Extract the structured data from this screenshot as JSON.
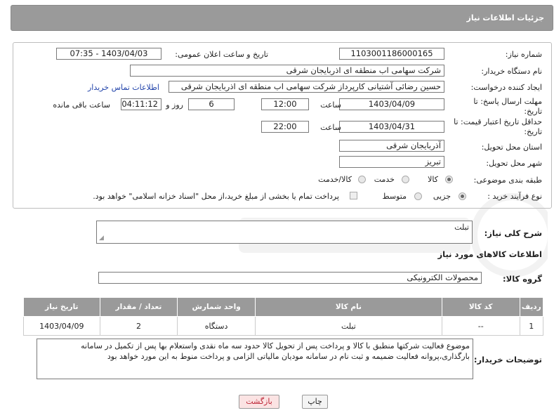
{
  "header": {
    "title": "جزئیات اطلاعات نیاز"
  },
  "form": {
    "need_number_label": "شماره نیاز:",
    "need_number": "1103001186000165",
    "announce_label": "تاریخ و ساعت اعلان عمومی:",
    "announce_value": "1403/04/03 - 07:35",
    "buyer_org_label": "نام دستگاه خریدار:",
    "buyer_org": "شرکت سهامی اب منطقه ای اذربایجان شرقی",
    "creator_label": "ایجاد کننده درخواست:",
    "creator": "حسین رضائی آشتیانی کارپرداز شرکت سهامی اب منطقه ای اذربایجان شرقی",
    "contact_link": "اطلاعات تماس خریدار",
    "deadline_label_1": "مهلت ارسال پاسخ: تا",
    "deadline_label_2": "تاریخ:",
    "deadline_date": "1403/04/09",
    "time_label": "ساعت",
    "deadline_time": "12:00",
    "days_value": "6",
    "days_label": "روز و",
    "remaining_time": "04:11:12",
    "remaining_label": "ساعت باقی مانده",
    "validity_label_1": "حداقل تاریخ اعتبار قیمت: تا",
    "validity_label_2": "تاریخ:",
    "validity_date": "1403/04/31",
    "validity_time": "22:00",
    "province_label": "استان محل تحویل:",
    "province": "آذربایجان شرقی",
    "city_label": "شهر محل تحویل:",
    "city": "تبریز",
    "category_label": "طبقه بندی موضوعی:",
    "category_options": [
      "کالا",
      "خدمت",
      "کالا/خدمت"
    ],
    "process_label": "نوع فرآیند خرید :",
    "process_options": [
      "جزیی",
      "متوسط"
    ],
    "payment_note": "پرداخت تمام یا بخشی از مبلغ خرید،از محل \"اسناد خزانه اسلامی\" خواهد بود."
  },
  "summary": {
    "label": "شرح کلی نیاز:",
    "value": "تبلت"
  },
  "goods_section": {
    "title": "اطلاعات کالاهای مورد نیاز",
    "group_label": "گروه کالا:",
    "group_value": "محصولات الکترونیکی"
  },
  "table": {
    "headers": [
      "ردیف",
      "کد کالا",
      "نام کالا",
      "واحد شمارش",
      "تعداد / مقدار",
      "تاریخ نیاز"
    ],
    "rows": [
      [
        "1",
        "--",
        "تبلت",
        "دستگاه",
        "2",
        "1403/04/09"
      ]
    ]
  },
  "buyer_notes": {
    "label": "توضیحات خریدار:",
    "value": "موضوع فعالیت شرکتها منطبق با کالا و پرداخت پس از تحویل کالا حدود سه  ماه نقدی واستعلام بها پس از تکمیل در سامانه بارگذاری،پروانه فعالیت ضمیمه و ثبت نام در سامانه مودیان مالیاتی الزامی و پرداخت منوط به این مورد خواهد بود"
  },
  "buttons": {
    "print": "چاپ",
    "back": "بازگشت"
  },
  "colors": {
    "header_bg": "#9a9a9a",
    "link": "#2244aa",
    "back_button_bg": "#fbe3e3"
  }
}
